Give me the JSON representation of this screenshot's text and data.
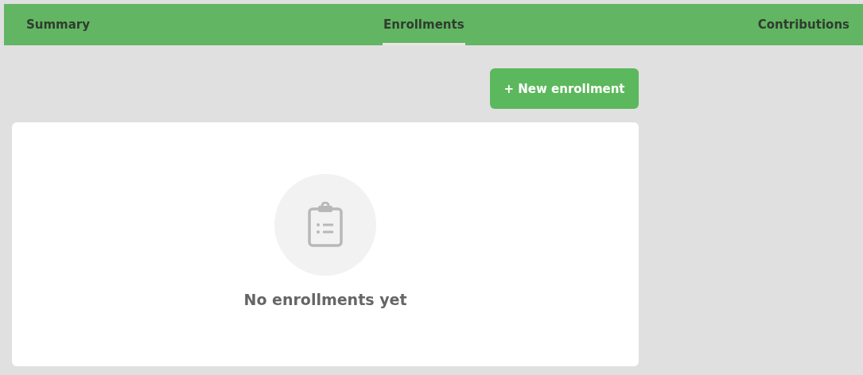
{
  "tabs": [
    {
      "label": "Summary",
      "selected": false
    },
    {
      "label": "Enrollments",
      "selected": true
    },
    {
      "label": "Contributions",
      "selected": false
    }
  ],
  "new_button": {
    "label": "+ New enrollment"
  },
  "empty_state": {
    "message": "No enrollments yet"
  }
}
